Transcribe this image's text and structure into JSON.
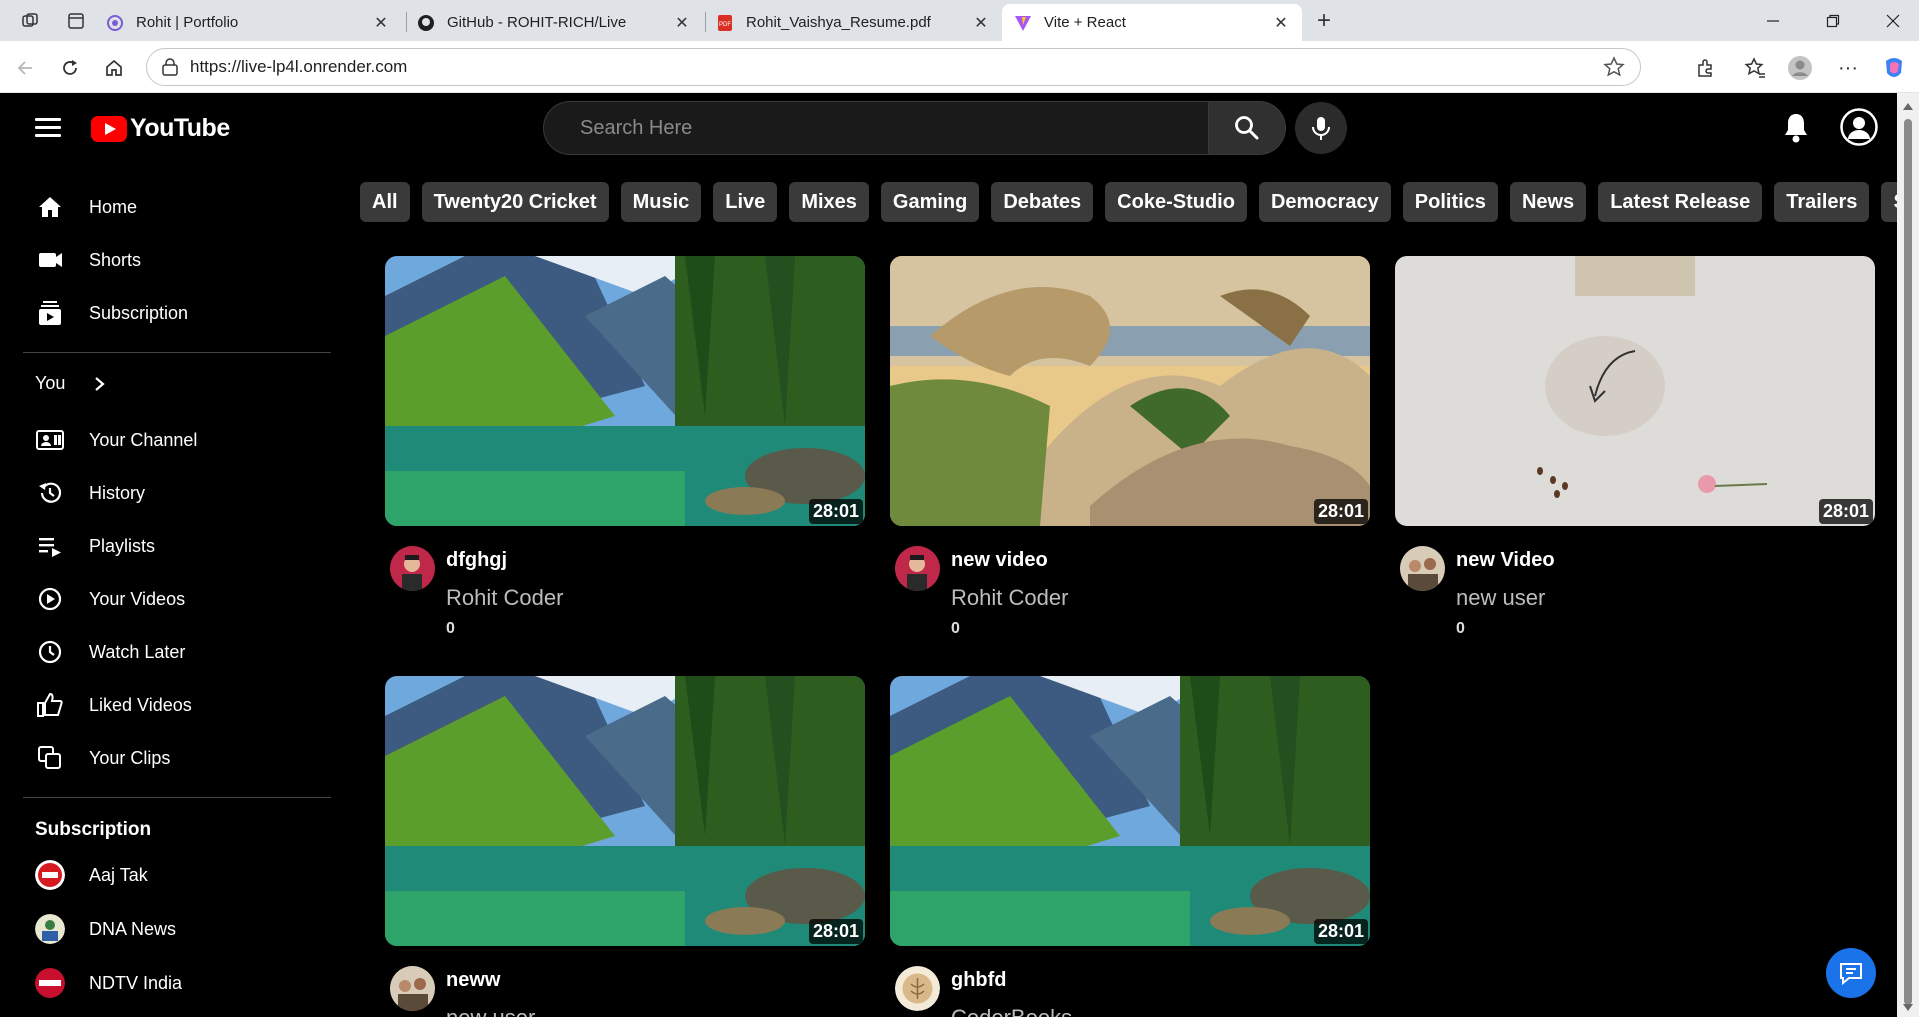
{
  "browser": {
    "tabs": [
      {
        "title": "Rohit | Portfolio",
        "favicon": "portfolio-icon"
      },
      {
        "title": "GitHub - ROHIT-RICH/Live",
        "favicon": "github-icon"
      },
      {
        "title": "Rohit_Vaishya_Resume.pdf",
        "favicon": "pdf-icon"
      },
      {
        "title": "Vite + React",
        "favicon": "vite-icon",
        "active": true
      }
    ],
    "url": "https://live-lp4l.onrender.com"
  },
  "header": {
    "logo_text": "YouTube",
    "search_placeholder": "Search Here"
  },
  "sidebar": {
    "main": [
      {
        "label": "Home",
        "icon": "home-icon"
      },
      {
        "label": "Shorts",
        "icon": "shorts-icon"
      },
      {
        "label": "Subscription",
        "icon": "subscription-icon"
      }
    ],
    "you_label": "You",
    "you_items": [
      {
        "label": "Your Channel",
        "icon": "channel-icon"
      },
      {
        "label": "History",
        "icon": "history-icon"
      },
      {
        "label": "Playlists",
        "icon": "playlist-icon"
      },
      {
        "label": "Your Videos",
        "icon": "video-icon"
      },
      {
        "label": "Watch Later",
        "icon": "clock-icon"
      },
      {
        "label": "Liked Videos",
        "icon": "like-icon"
      },
      {
        "label": "Your Clips",
        "icon": "clips-icon"
      }
    ],
    "subscription_heading": "Subscription",
    "subscriptions": [
      {
        "label": "Aaj Tak"
      },
      {
        "label": "DNA News"
      },
      {
        "label": "NDTV India"
      }
    ]
  },
  "chips": [
    "All",
    "Twenty20 Cricket",
    "Music",
    "Live",
    "Mixes",
    "Gaming",
    "Debates",
    "Coke-Studio",
    "Democracy",
    "Politics",
    "News",
    "Latest Release",
    "Trailers",
    "Serials"
  ],
  "videos": [
    {
      "title": "dfghgj",
      "channel": "Rohit Coder",
      "views": "0",
      "duration": "28:01"
    },
    {
      "title": "new video",
      "channel": "Rohit Coder",
      "views": "0",
      "duration": "28:01"
    },
    {
      "title": "new Video",
      "channel": "new user",
      "views": "0",
      "duration": "28:01"
    },
    {
      "title": "neww",
      "channel": "new user",
      "views": "",
      "duration": "28:01"
    },
    {
      "title": "ghbfd",
      "channel": "CoderBooks",
      "views": "",
      "duration": "28:01"
    }
  ],
  "colors": {
    "brand_red": "#ff0000",
    "chip_bg": "#3a3a3a",
    "accent_blue": "#1a73e8"
  }
}
